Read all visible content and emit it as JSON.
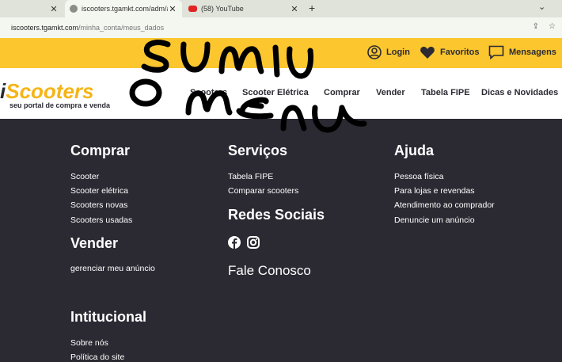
{
  "browser": {
    "tabs": [
      {
        "title": ""
      },
      {
        "title": "iscooters.tgamkt.com/adm/auten"
      },
      {
        "title": "(58) YouTube"
      }
    ],
    "new_tab": "+",
    "url_host": "iscooters.tgamkt.com",
    "url_path": "/minha_conta/meus_dados"
  },
  "topbar": {
    "login": "Login",
    "favoritos": "Favoritos",
    "mensagens": "Mensagens"
  },
  "logo": {
    "name_i": "i",
    "name_rest": "Scooters",
    "tagline": "seu portal de compra e venda"
  },
  "nav": [
    "Scooters",
    "Scooter Elétrica",
    "Comprar",
    "Vender",
    "Tabela FIPE",
    "Dicas e Novidades"
  ],
  "annotation": "SUMIU O MENU",
  "footer": {
    "comprar": {
      "heading": "Comprar",
      "links": [
        "Scooter",
        "Scooter elétrica",
        "Scooters novas",
        "Scooters usadas"
      ]
    },
    "vender": {
      "heading": "Vender",
      "links": [
        "gerenciar meu anúncio"
      ]
    },
    "servicos": {
      "heading": "Serviços",
      "links": [
        "Tabela FIPE",
        "Comparar scooters"
      ]
    },
    "redes": {
      "heading": "Redes Sociais"
    },
    "fale": "Fale Conosco",
    "ajuda": {
      "heading": "Ajuda",
      "links": [
        "Pessoa física",
        "Para lojas e revendas",
        "Atendimento ao comprador",
        "Denuncie um anúncio"
      ]
    },
    "institucional": {
      "heading": "Intitucional",
      "links": [
        "Sobre nós",
        "Política do site"
      ]
    }
  },
  "colors": {
    "brand_yellow": "#fbc62e",
    "footer_bg": "#2b2a33"
  }
}
